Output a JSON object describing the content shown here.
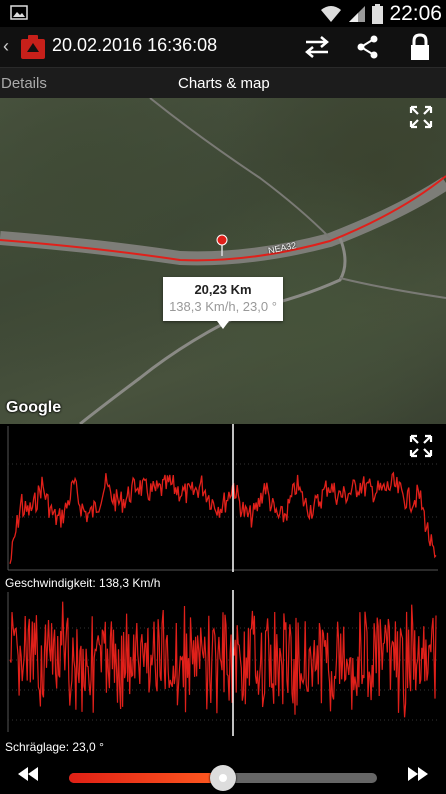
{
  "status_bar": {
    "time": "22:06"
  },
  "action_bar": {
    "title": "20.02.2016 16:36:08"
  },
  "tabs": {
    "details": "Details",
    "charts_map": "Charts & map"
  },
  "map": {
    "info_distance": "20,23 Km",
    "info_detail": "138,3 Km/h, 23,0 °",
    "road_label": "NEA32",
    "attribution": "Google"
  },
  "charts": {
    "speed_label": "Geschwindigkeit: 138,3 Km/h",
    "lean_label": "Schräglage: 23,0 °",
    "series_color": "#e0201a"
  },
  "player": {
    "position": 0.5
  },
  "icons": [
    "image-icon",
    "wifi-icon",
    "signal-icon",
    "battery-icon",
    "back-chevron-icon",
    "app-icon",
    "swap-icon",
    "share-icon",
    "lock-icon",
    "expand-icon",
    "rewind-icon",
    "fast-forward-icon"
  ]
}
